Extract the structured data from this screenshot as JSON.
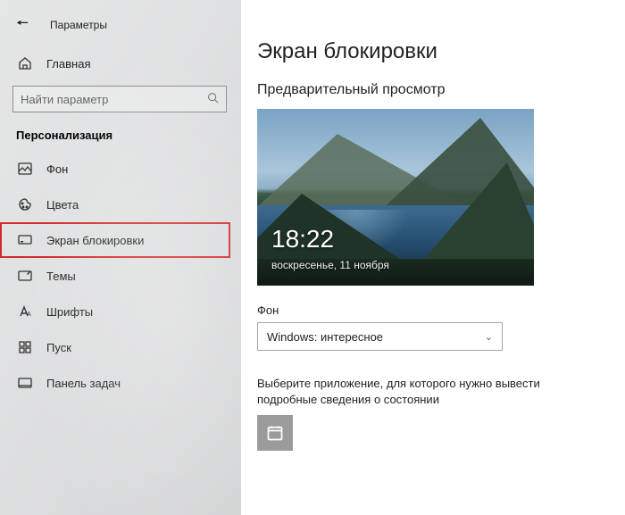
{
  "window_title": "Параметры",
  "sidebar": {
    "home_label": "Главная",
    "search_placeholder": "Найти параметр",
    "section_heading": "Персонализация",
    "items": [
      {
        "icon": "image-icon",
        "label": "Фон"
      },
      {
        "icon": "palette-icon",
        "label": "Цвета"
      },
      {
        "icon": "lockscreen-icon",
        "label": "Экран блокировки",
        "highlighted": true
      },
      {
        "icon": "theme-icon",
        "label": "Темы"
      },
      {
        "icon": "font-icon",
        "label": "Шрифты"
      },
      {
        "icon": "start-icon",
        "label": "Пуск"
      },
      {
        "icon": "taskbar-icon",
        "label": "Панель задач"
      }
    ]
  },
  "main": {
    "title": "Экран блокировки",
    "preview_heading": "Предварительный просмотр",
    "preview_time": "18:22",
    "preview_date": "воскресенье, 11 ноября",
    "background_label": "Фон",
    "background_value": "Windows: интересное",
    "app_info": "Выберите приложение, для которого нужно вывести подробные сведения о состоянии"
  }
}
